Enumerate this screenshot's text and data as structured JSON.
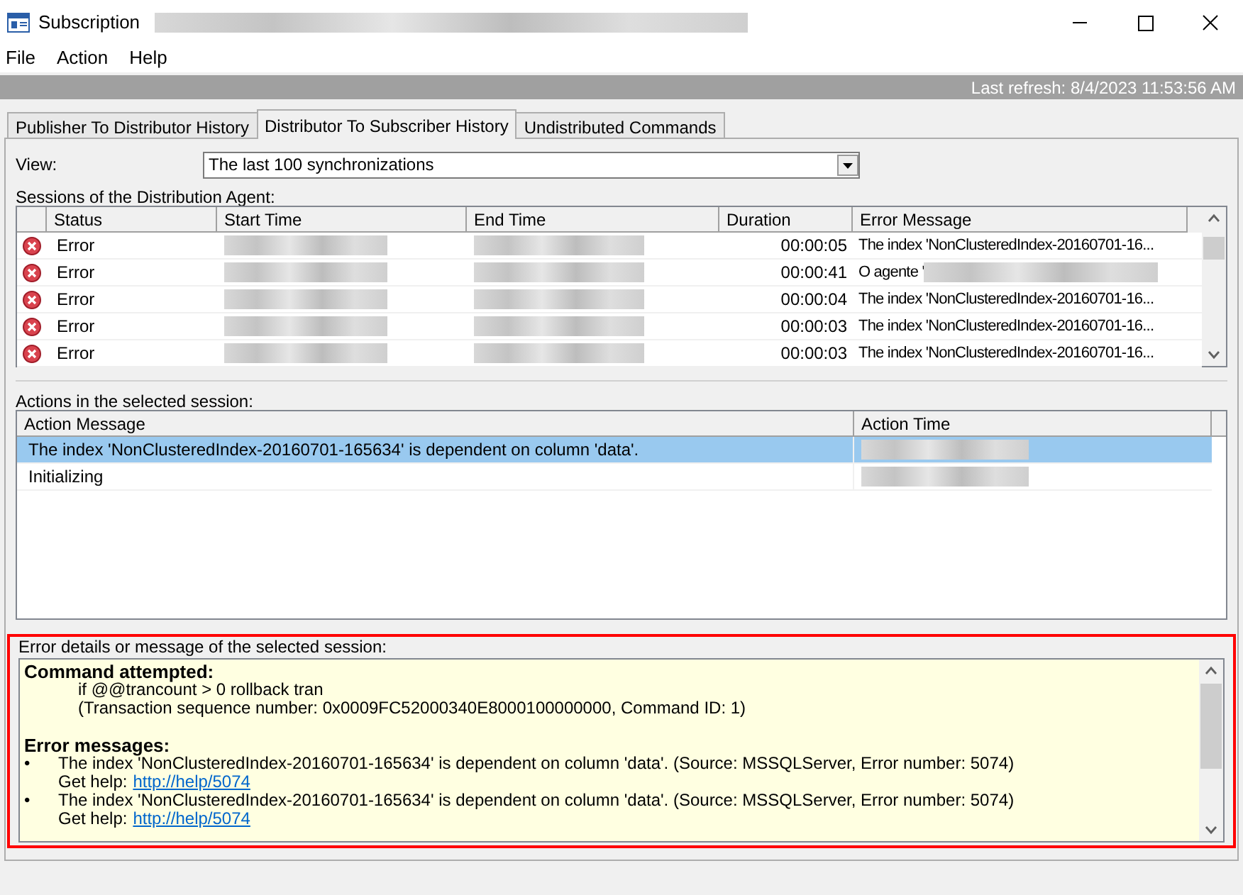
{
  "window": {
    "title": "Subscription"
  },
  "menu": [
    {
      "label": "File"
    },
    {
      "label": "Action"
    },
    {
      "label": "Help"
    }
  ],
  "refresh_bar": {
    "text": "Last refresh: 8/4/2023 11:53:56 AM"
  },
  "tabs": [
    {
      "label": "Publisher To Distributor History",
      "selected": false
    },
    {
      "label": "Distributor To Subscriber History",
      "selected": true
    },
    {
      "label": "Undistributed Commands",
      "selected": false
    }
  ],
  "view": {
    "label": "View:",
    "value": "The last 100 synchronizations"
  },
  "sessions": {
    "label": "Sessions of the Distribution Agent:",
    "columns": [
      "Status",
      "Start Time",
      "End Time",
      "Duration",
      "Error Message"
    ],
    "rows": [
      {
        "status": "Error",
        "duration": "00:00:05",
        "error_message": "The index 'NonClusteredIndex-20160701-16..."
      },
      {
        "status": "Error",
        "duration": "00:00:41",
        "error_message": "O agente '"
      },
      {
        "status": "Error",
        "duration": "00:00:04",
        "error_message": "The index 'NonClusteredIndex-20160701-16..."
      },
      {
        "status": "Error",
        "duration": "00:00:03",
        "error_message": "The index 'NonClusteredIndex-20160701-16..."
      },
      {
        "status": "Error",
        "duration": "00:00:03",
        "error_message": "The index 'NonClusteredIndex-20160701-16..."
      }
    ]
  },
  "actions": {
    "label": "Actions in the selected session:",
    "columns": [
      "Action Message",
      "Action Time"
    ],
    "rows": [
      {
        "message": "The index 'NonClusteredIndex-20160701-165634' is dependent on column 'data'.",
        "selected": true
      },
      {
        "message": "Initializing",
        "selected": false
      }
    ]
  },
  "error_details": {
    "label": "Error details or message of the selected session:",
    "highlighted": true,
    "blocks": [
      {
        "kind": "heading",
        "text": "Command attempted:"
      },
      {
        "kind": "indent",
        "text": "if @@trancount > 0 rollback tran"
      },
      {
        "kind": "indent",
        "text": "(Transaction sequence number: 0x0009FC52000340E8000100000000, Command ID: 1)"
      },
      {
        "kind": "gap"
      },
      {
        "kind": "heading",
        "text": "Error messages:"
      },
      {
        "kind": "bullet",
        "marker": "•",
        "text": "The index 'NonClusteredIndex-20160701-165634' is dependent on column 'data'. (Source: MSSQLServer, Error number: 5074)",
        "help_label": "Get help:",
        "link": "http://help/5074"
      },
      {
        "kind": "bullet",
        "marker": "•",
        "text": "The index 'NonClusteredIndex-20160701-165634' is dependent on column 'data'. (Source: MSSQLServer, Error number: 5074)",
        "help_label": "Get help:",
        "link": "http://help/5074"
      }
    ]
  }
}
